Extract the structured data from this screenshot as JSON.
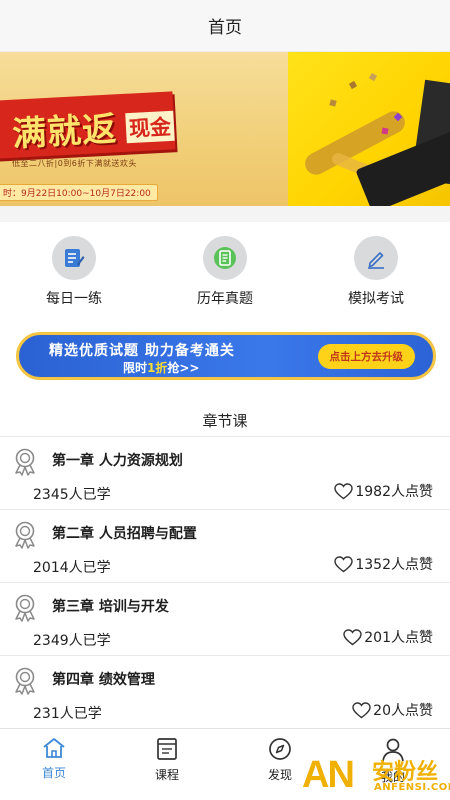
{
  "header": {
    "title": "首页"
  },
  "banner": {
    "promo_main": "满就返",
    "promo_cash": "现金",
    "promo_sub": "低至二八折|0到6折下满就送欢头",
    "promo_date": "时：9月22日10:00~10月7日22:00",
    "slide_count": 3,
    "active_slide": 3
  },
  "quick_actions": [
    {
      "label": "每日一练",
      "icon": "daily-practice-icon"
    },
    {
      "label": "历年真题",
      "icon": "past-exams-icon"
    },
    {
      "label": "模拟考试",
      "icon": "mock-exam-icon"
    }
  ],
  "upgrade_banner": {
    "line1": "精选优质试题 助力备考通关",
    "line2_pre": "限时",
    "line2_highlight": "1折",
    "line2_post": "抢>>",
    "cta": "点击上方去升级"
  },
  "section": {
    "title": "章节课"
  },
  "chapters": [
    {
      "title": "第一章 人力资源规划",
      "learners": "2345人已学",
      "likes": "1982人点赞"
    },
    {
      "title": "第二章 人员招聘与配置",
      "learners": "2014人已学",
      "likes": "1352人点赞"
    },
    {
      "title": "第三章 培训与开发",
      "learners": "2349人已学",
      "likes": "201人点赞"
    },
    {
      "title": "第四章 绩效管理",
      "learners": "231人已学",
      "likes": "20人点赞"
    }
  ],
  "tabbar": {
    "items": [
      {
        "label": "首页",
        "icon": "home-icon",
        "active": true
      },
      {
        "label": "课程",
        "icon": "course-icon",
        "active": false
      },
      {
        "label": "发现",
        "icon": "compass-icon",
        "active": false
      },
      {
        "label": "我的",
        "icon": "user-icon",
        "active": false
      }
    ]
  },
  "watermark": {
    "big": "AN",
    "cn": "安粉丝",
    "en": "ANFENSI.COM"
  },
  "colors": {
    "accent": "#3e88d6",
    "promo_red": "#d7271c",
    "banner_blue": "#2b62d3",
    "cta_yellow": "#ffd21a"
  }
}
